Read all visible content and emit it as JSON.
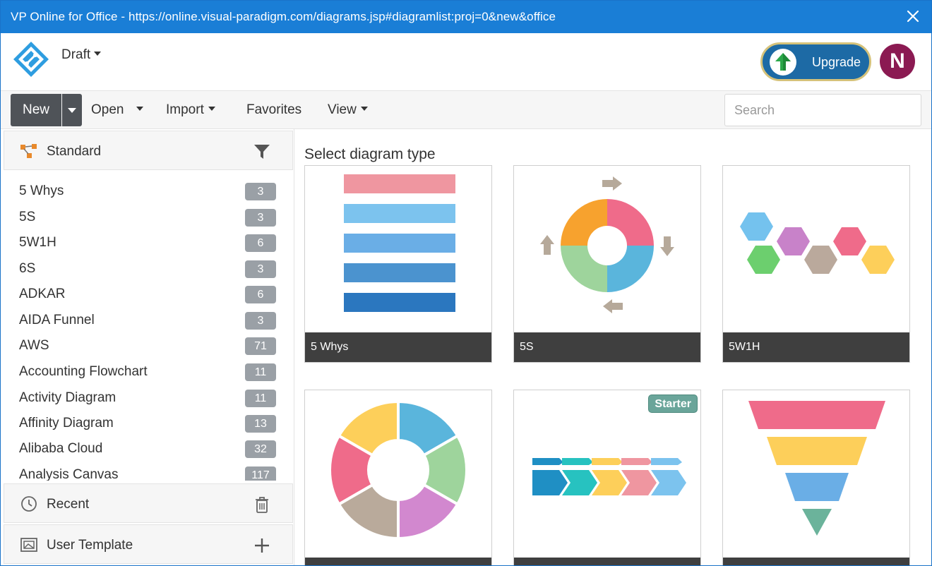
{
  "window": {
    "title": "VP Online for Office - https://online.visual-paradigm.com/diagrams.jsp#diagramlist:proj=0&new&office",
    "close_icon": "close-icon"
  },
  "header": {
    "project_name": "Draft",
    "upgrade_label": "Upgrade",
    "avatar_initial": "N",
    "colors": {
      "titlebar": "#1a7ed6",
      "upgrade": "#1d6aa5",
      "avatar": "#8b1a52"
    }
  },
  "toolbar": {
    "new_label": "New",
    "open_label": "Open",
    "import_label": "Import",
    "favorites_label": "Favorites",
    "view_label": "View",
    "search_placeholder": "Search"
  },
  "sidebar": {
    "standard_label": "Standard",
    "recent_label": "Recent",
    "user_template_label": "User Template",
    "items": [
      {
        "name": "5 Whys",
        "count": "3"
      },
      {
        "name": "5S",
        "count": "3"
      },
      {
        "name": "5W1H",
        "count": "6"
      },
      {
        "name": "6S",
        "count": "3"
      },
      {
        "name": "ADKAR",
        "count": "6"
      },
      {
        "name": "AIDA Funnel",
        "count": "3"
      },
      {
        "name": "AWS",
        "count": "71"
      },
      {
        "name": "Accounting Flowchart",
        "count": "11"
      },
      {
        "name": "Activity Diagram",
        "count": "11"
      },
      {
        "name": "Affinity Diagram",
        "count": "13"
      },
      {
        "name": "Alibaba Cloud",
        "count": "32"
      },
      {
        "name": "Analysis Canvas",
        "count": "117"
      }
    ]
  },
  "main": {
    "heading": "Select diagram type",
    "cards": [
      {
        "caption": "5 Whys",
        "badge": ""
      },
      {
        "caption": "5S",
        "badge": ""
      },
      {
        "caption": "5W1H",
        "badge": ""
      },
      {
        "caption": "",
        "badge": ""
      },
      {
        "caption": "",
        "badge": "Starter"
      },
      {
        "caption": "",
        "badge": ""
      }
    ]
  }
}
